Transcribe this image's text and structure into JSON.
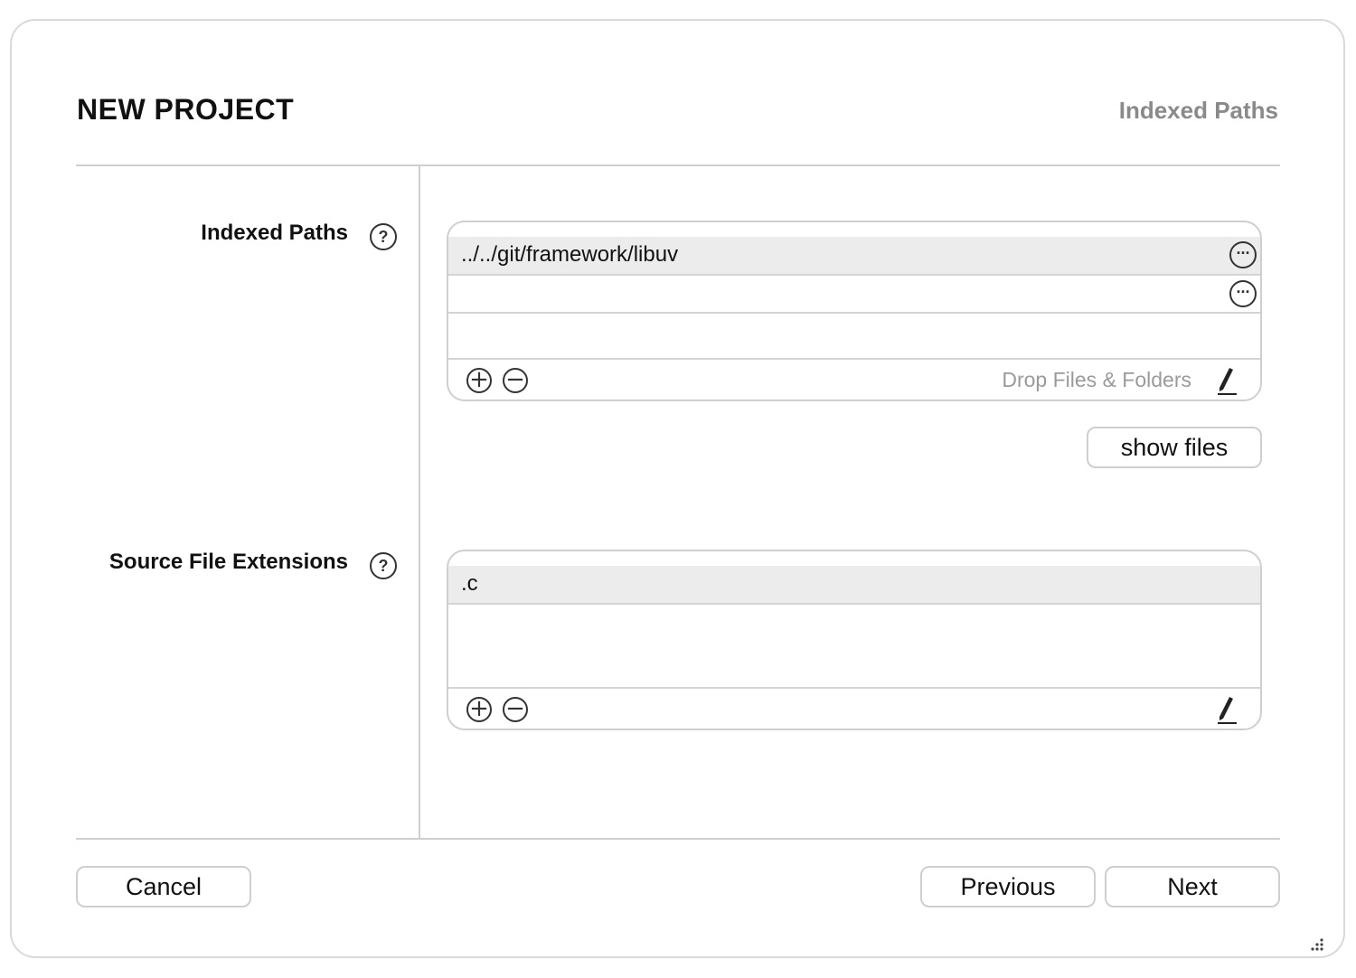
{
  "dialog": {
    "title": "NEW PROJECT",
    "step": "Indexed Paths"
  },
  "indexed_paths": {
    "label": "Indexed Paths",
    "help_icon": "question-mark-circle-icon",
    "rows": [
      {
        "value": "../../git/framework/libuv",
        "selected": true
      },
      {
        "value": "",
        "selected": false
      }
    ],
    "drop_hint": "Drop Files & Folders",
    "show_files_label": "show files"
  },
  "source_extensions": {
    "label": "Source File Extensions",
    "help_icon": "question-mark-circle-icon",
    "rows": [
      {
        "value": ".c",
        "selected": true
      }
    ]
  },
  "footer": {
    "cancel_label": "Cancel",
    "previous_label": "Previous",
    "next_label": "Next"
  },
  "colors": {
    "selected_row": "#ececec",
    "border": "#cfcfcf",
    "hint_text": "#9a9a9a",
    "step_text": "#8a8a8a"
  }
}
